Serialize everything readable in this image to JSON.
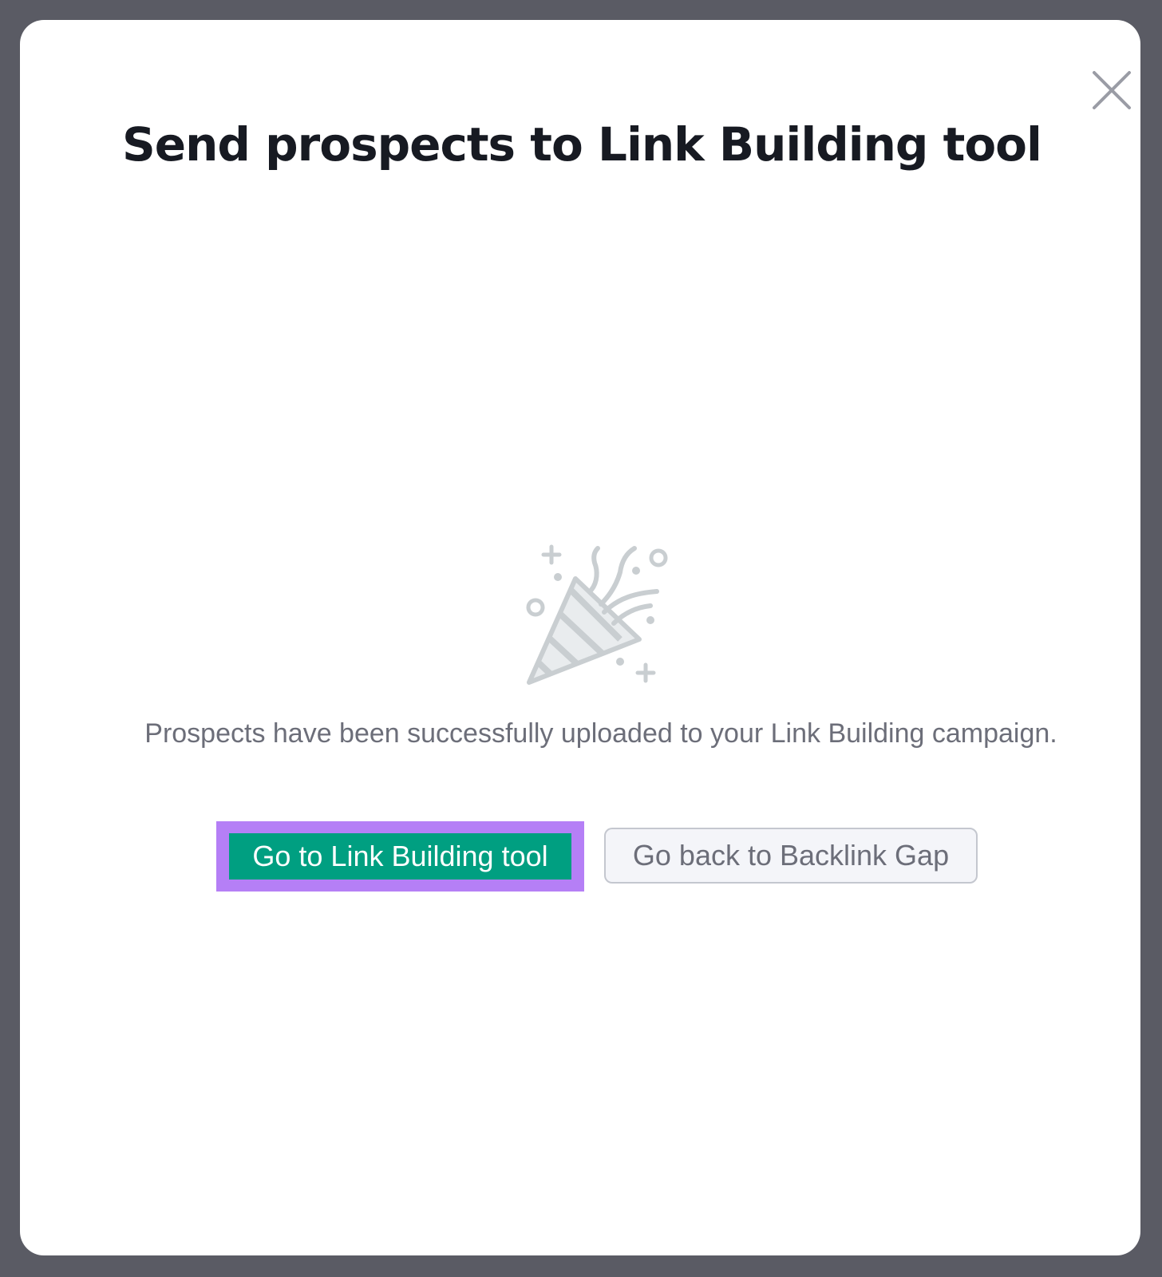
{
  "modal": {
    "title": "Send prospects to Link Building tool",
    "close_icon": "close-icon",
    "illustration_icon": "party-popper-icon",
    "message": "Prospects have been successfully uploaded to your Link Building campaign.",
    "primary_button": "Go to Link Building tool",
    "secondary_button": "Go back to Backlink Gap"
  },
  "colors": {
    "backdrop": "#5a5b64",
    "primary": "#009f81",
    "highlight": "#b57ff6",
    "title_text": "#171a22",
    "muted_text": "#6c6e79"
  }
}
